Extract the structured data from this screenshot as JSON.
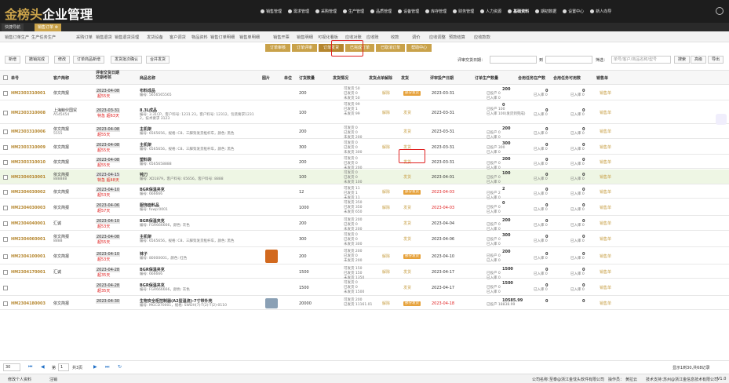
{
  "brand": {
    "logo_gold": "金榜头",
    "logo_white": "企业管理"
  },
  "nav": [
    {
      "label": "销售管理"
    },
    {
      "label": "需求管理"
    },
    {
      "label": "采购管理"
    },
    {
      "label": "生产管理"
    },
    {
      "label": "品质管理"
    },
    {
      "label": "设备管理"
    },
    {
      "label": "库存管理"
    },
    {
      "label": "财务管理"
    },
    {
      "label": "人力资源"
    },
    {
      "label": "基础资料"
    },
    {
      "label": "期初数据"
    },
    {
      "label": "设置中心"
    },
    {
      "label": "新人向导"
    }
  ],
  "tabs": [
    {
      "label": "快捷导航"
    },
    {
      "label": "销售订单 ⊗"
    }
  ],
  "menu": [
    "销售订单生产",
    "生产任务生产",
    "采购订单",
    "销售退货",
    "销售退货清理",
    "发货设备",
    "客户调货",
    "物品资料",
    "销售订单明细",
    "销售单明细",
    "销售开票",
    "销售明细",
    "可视化看板",
    "应收对账",
    "应收账",
    "收款",
    "调价",
    "应收调整",
    "预款结算",
    "应收款款"
  ],
  "subtabs": [
    "订单审核",
    "订单评审",
    "订单发货",
    "已完成订单",
    "已取消订单",
    "帮助中心"
  ],
  "toolbar": [
    "新增",
    "撤销完成",
    "修改",
    "订单商品新增",
    "发货批次确认",
    "合并发货"
  ],
  "filter": {
    "date_label": "评审交货日期：",
    "date_sep": "到",
    "search_label": "筛选：",
    "search_placeholder": "单号/客户/商品名称/型号",
    "search_btn": "搜索",
    "adv_btn": "高级",
    "export_btn": "导出"
  },
  "columns": [
    "单号",
    "客户简称",
    "评审交货日期&\n交期考核",
    "商品名称",
    "图片",
    "单位",
    "订货数量",
    "发货情况",
    "发货点单解除",
    "发货",
    "评审投产日期",
    "订单生产数量",
    "合用任务在产数",
    "合用任务可用数",
    "销售单"
  ],
  "rows": [
    {
      "id": "HM2303310001",
      "cust": "依文简报",
      "cust2": "",
      "date": "2023-04-08",
      "overdue": "超55天",
      "name": "布料成品",
      "spec": "编号: 5656565565",
      "unit": "",
      "qty": "200",
      "ship": [
        "可发货 50",
        "已发货 0",
        "未发货 50"
      ],
      "unlock": "解除",
      "status": "部分发货",
      "sbadge": true,
      "pdate": "2023-03-31",
      "pdred": false,
      "prod": [
        "200",
        "已投产 0",
        "已入库 0"
      ],
      "inprod": [
        "0",
        "已入库 0"
      ],
      "avail": [
        "0",
        "已入库 0"
      ],
      "sales": "销售单",
      "green": false,
      "img": false
    },
    {
      "id": "HM2303310008",
      "cust": "上海鲸伙国贸",
      "cust2": "A545454",
      "date": "2023-03-31",
      "overdue": "特急 超63天",
      "name": "8.3L成品",
      "spec": "编号: 3.31CP，客户料号: 1231 23，客户料号: 12312，包装要求1231 2，技术要求 3123",
      "unit": "",
      "qty": "100",
      "ship": [
        "可发货 99",
        "已发货 1",
        "未发货 99"
      ],
      "unlock": "解除",
      "status": "发货",
      "sbadge": false,
      "pdate": "2023-03-31",
      "pdred": false,
      "prod": [
        "0",
        "已投产 100",
        "已入库 100(发货到完成)"
      ],
      "inprod": [
        "0",
        "已入库 0"
      ],
      "avail": [
        "0",
        "已入库 0"
      ],
      "sales": "销售单",
      "green": false,
      "img": false
    },
    {
      "id": "HM2303310006",
      "cust": "依文简报",
      "cust2": "5555",
      "date": "2023-04-08",
      "overdue": "超55天",
      "name": "主机架",
      "spec": "编号: 6565656，规格: C8、三脚架发货框杆车，颜色: 黑色",
      "unit": "",
      "qty": "200",
      "ship": [
        "可发货 0",
        "已发货 0",
        "未发货 200"
      ],
      "unlock": "",
      "status": "发货",
      "sbadge": false,
      "pdate": "2023-03-31",
      "pdred": false,
      "prod": [
        "200",
        "已投产 0",
        "已入库 0"
      ],
      "inprod": [
        "0",
        "已入库 0"
      ],
      "avail": [
        "0",
        "已入库 0"
      ],
      "sales": "销售单",
      "green": false,
      "img": false
    },
    {
      "id": "HM2303310009",
      "cust": "依文简报",
      "cust2": "",
      "date": "2023-04-08",
      "overdue": "超55天",
      "name": "主机架",
      "spec": "编号: 6565656，规格: C8、三脚架发货框杆车，颜色: 黑色",
      "unit": "",
      "qty": "300",
      "ship": [
        "可发货 0",
        "已发货 0",
        "未发货 300"
      ],
      "unlock": "解除",
      "status": "发货",
      "sbadge": false,
      "pdate": "2023-03-31",
      "pdred": false,
      "prod": [
        "300",
        "已投产 300",
        "已入库 0"
      ],
      "inprod": [
        "0",
        "已入库 0"
      ],
      "avail": [
        "0",
        "已入库 0"
      ],
      "sales": "销售单",
      "green": false,
      "img": false
    },
    {
      "id": "HM2303310010",
      "cust": "依文简报",
      "cust2": "",
      "date": "2023-04-08",
      "overdue": "超55天",
      "name": "塑料袋",
      "spec": "编号: 6565658888",
      "unit": "",
      "qty": "200",
      "ship": [
        "可发货 0",
        "已发货 0",
        "未发货 200"
      ],
      "unlock": "",
      "status": "发货",
      "sbadge": false,
      "pdate": "2023-03-31",
      "pdred": false,
      "prod": [
        "200",
        "已投产 0",
        "已入库 0"
      ],
      "inprod": [
        "0",
        "已入库 0"
      ],
      "avail": [
        "0",
        "已入库 0"
      ],
      "sales": "销售单",
      "green": false,
      "img": false
    },
    {
      "id": "HM2304010001",
      "cust": "依文简报",
      "cust2": "888888",
      "date": "2023-04-15",
      "overdue": "特急 超48天",
      "name": "钝刀",
      "spec": "编号: XD1879，客户料号: 65656，客户料号: 8888",
      "unit": "",
      "qty": "100",
      "ship": [
        "可发货 0",
        "已发货 0",
        "未发货 100"
      ],
      "unlock": "",
      "status": "发货",
      "sbadge": false,
      "pdate": "2023-04-01",
      "pdred": false,
      "prod": [
        "100",
        "已投产 0",
        "已入库 0"
      ],
      "inprod": [
        "0",
        "已入库 0"
      ],
      "avail": [
        "0",
        "已入库 0"
      ],
      "sales": "销售单",
      "green": true,
      "img": false
    },
    {
      "id": "HM2304030002",
      "cust": "依文简报",
      "cust2": "",
      "date": "2023-04-10",
      "overdue": "超53天",
      "name": "BGR保温夹克",
      "spec": "编号: 666666",
      "unit": "",
      "qty": "12",
      "ship": [
        "可发货 11",
        "已发货 1",
        "未发货 11"
      ],
      "unlock": "解除",
      "status": "部分发货",
      "sbadge": true,
      "pdate": "2023-04-03",
      "pdred": true,
      "prod": [
        "2",
        "已投产 2",
        "已入库 0"
      ],
      "inprod": [
        "0",
        "已入库 0"
      ],
      "avail": [
        "0",
        "已入库 0"
      ],
      "sales": "销售单",
      "green": false,
      "img": false
    },
    {
      "id": "HM2304030003",
      "cust": "依文简报",
      "cust2": "",
      "date": "2023-04-06",
      "overdue": "超57天",
      "name": "服饰面料品",
      "spec": "编号: fuwp:0001",
      "unit": "",
      "qty": "1000",
      "ship": [
        "可发货 350",
        "已发货 350",
        "未发货 650"
      ],
      "unlock": "解除",
      "status": "发货",
      "sbadge": false,
      "pdate": "2023-04-03",
      "pdred": true,
      "prod": [
        "0",
        "已投产 0",
        "已入库 0"
      ],
      "inprod": [
        "0",
        "已入库 0"
      ],
      "avail": [
        "0",
        "已入库 0"
      ],
      "sales": "销售单",
      "green": false,
      "img": false
    },
    {
      "id": "HM2304040001",
      "cust": "汇诚",
      "cust2": "",
      "date": "2023-04-10",
      "overdue": "超53天",
      "name": "BGR保温夹克",
      "spec": "编号: FGR666666，颜色: 灰色",
      "unit": "",
      "qty": "200",
      "ship": [
        "可发货 200",
        "已发货 0",
        "未发货 200"
      ],
      "unlock": "",
      "status": "发货",
      "sbadge": false,
      "pdate": "2023-04-04",
      "pdred": false,
      "prod": [
        "200",
        "已投产 0",
        "已入库 0"
      ],
      "inprod": [
        "0",
        "已入库 0"
      ],
      "avail": [
        "0",
        "已入库 0"
      ],
      "sales": "销售单",
      "green": false,
      "img": false
    },
    {
      "id": "HM2304060001",
      "cust": "依文简报",
      "cust2": "8888",
      "date": "2023-04-08",
      "overdue": "超55天",
      "name": "主机架",
      "spec": "编号: 6565656，规格: C8、三脚架发货框杆车，颜色: 黑色",
      "unit": "",
      "qty": "300",
      "ship": [
        "可发货 0",
        "已发货 0",
        "未发货 300"
      ],
      "unlock": "",
      "status": "发货",
      "sbadge": false,
      "pdate": "2023-04-06",
      "pdred": false,
      "prod": [
        "300",
        "已投产 0",
        "已入库 0"
      ],
      "inprod": [
        "0",
        "已入库 0"
      ],
      "avail": [
        "0",
        "已入库 0"
      ],
      "sales": "销售单",
      "green": false,
      "img": false
    },
    {
      "id": "HM2304100001",
      "cust": "依文简报",
      "cust2": "",
      "date": "2023-04-10",
      "overdue": "超53天",
      "name": "袜子",
      "spec": "编号: 80000001，颜色: 红色",
      "unit": "",
      "qty": "200",
      "ship": [
        "可发货 200",
        "已发货 0",
        "未发货 200"
      ],
      "unlock": "解除",
      "status": "部分发货",
      "sbadge": true,
      "pdate": "2023-04-10",
      "pdred": false,
      "prod": [
        "200",
        "已投产 0",
        "已入库 0"
      ],
      "inprod": [
        "0",
        "已入库 0"
      ],
      "avail": [
        "0",
        "已入库 0"
      ],
      "sales": "销售单",
      "green": false,
      "img": true
    },
    {
      "id": "HM2304170001",
      "cust": "汇诚",
      "cust2": "",
      "date": "2023-04-28",
      "overdue": "超35天",
      "name": "BGR保温夹克",
      "spec": "编号: 666666",
      "unit": "",
      "qty": "1500",
      "ship": [
        "可发货 150",
        "已发货 150",
        "未发货 1350"
      ],
      "unlock": "解除",
      "status": "发货",
      "sbadge": false,
      "pdate": "2023-04-17",
      "pdred": false,
      "prod": [
        "1500",
        "已投产 0",
        "已入库 0"
      ],
      "inprod": [
        "0",
        "已入库 0"
      ],
      "avail": [
        "0",
        "已入库 0"
      ],
      "sales": "销售单",
      "green": false,
      "img": false
    },
    {
      "id": "",
      "cust": "",
      "cust2": "",
      "date": "2023-04-28",
      "overdue": "超35天",
      "name": "BGR保温夹克",
      "spec": "编号: FGR666666，颜色: 灰色",
      "unit": "",
      "qty": "1500",
      "ship": [
        "可发货 0",
        "已发货 0",
        "未发货 1500"
      ],
      "unlock": "",
      "status": "发货",
      "sbadge": false,
      "pdate": "2023-04-17",
      "pdred": false,
      "prod": [
        "1500",
        "已投产 0",
        "已入库 0"
      ],
      "inprod": [
        "0",
        "已入库 0"
      ],
      "avail": [
        "0",
        "已入库 0"
      ],
      "sales": "销售单",
      "green": false,
      "img": false
    },
    {
      "id": "HM2304180003",
      "cust": "依文简报",
      "cust2": "",
      "date": "2023-04-30",
      "overdue": "",
      "name": "生物安全柜控制器(A2型温流)-7寸带外壳",
      "spec": "编号: MGCD70001，规格: SWDH(7)-T(2)-T(2)-0110",
      "unit": "",
      "qty": "20000",
      "ship": [
        "可发货 200",
        "已发货 11161.01",
        ""
      ],
      "unlock": "解除",
      "status": "部分发货",
      "sbadge": true,
      "pdate": "2023-04-18",
      "pdred": true,
      "prod": [
        "10585.99",
        "已投产 18838.99",
        ""
      ],
      "inprod": [
        "0",
        ""
      ],
      "avail": [
        "0",
        ""
      ],
      "sales": "销售单",
      "green": false,
      "img": true
    }
  ],
  "pager": {
    "size": "30",
    "page_label": "第",
    "page": "1",
    "total_label": "共3页",
    "summary": "显示1到30,共68记录"
  },
  "footer": {
    "user": "修改个人资料",
    "logout": "注销",
    "company_label": "公司名称：",
    "company": "至泰@浙江金忱头软件有限公司",
    "operator_label": "操作员：",
    "operator": "黄拉云",
    "support_label": "技术支持：",
    "support": "苏州@浙江金信息技术有限公司",
    "version": "V1.0"
  },
  "colors": {
    "gold": "#c9a24a",
    "header": "#1d1d1d",
    "red_highlight": "#e02020"
  }
}
